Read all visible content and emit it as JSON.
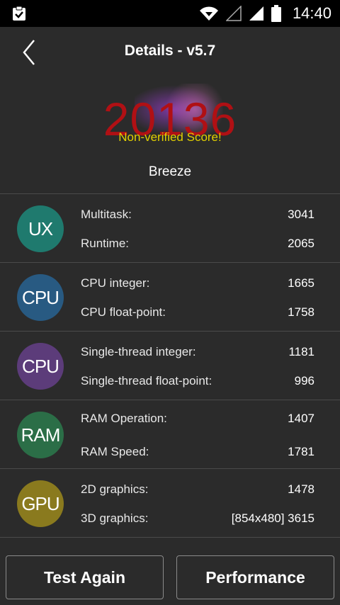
{
  "status_bar": {
    "time": "14:40"
  },
  "header": {
    "title": "Details - v5.7"
  },
  "score": {
    "value": "20136",
    "note": "Non-verified Score!",
    "device": "Breeze"
  },
  "categories": [
    {
      "badge": "UX",
      "color": "#1f7a6e",
      "items": [
        {
          "label": "Multitask:",
          "value": "3041"
        },
        {
          "label": "Runtime:",
          "value": "2065"
        }
      ]
    },
    {
      "badge": "CPU",
      "color": "#285a82",
      "items": [
        {
          "label": "CPU integer:",
          "value": "1665"
        },
        {
          "label": "CPU float-point:",
          "value": "1758"
        }
      ]
    },
    {
      "badge": "CPU",
      "color": "#5c3c7a",
      "items": [
        {
          "label": "Single-thread integer:",
          "value": "1181"
        },
        {
          "label": "Single-thread float-point:",
          "value": "996"
        }
      ]
    },
    {
      "badge": "RAM",
      "color": "#2b6e47",
      "items": [
        {
          "label": "RAM Operation:",
          "value": "1407"
        },
        {
          "label": "RAM Speed:",
          "value": "1781"
        }
      ]
    },
    {
      "badge": "GPU",
      "color": "#8a7a1e",
      "items": [
        {
          "label": "2D graphics:",
          "value": "1478"
        },
        {
          "label": "3D graphics:",
          "value": "[854x480] 3615"
        }
      ]
    }
  ],
  "buttons": {
    "test_again": "Test Again",
    "performance": "Performance"
  }
}
